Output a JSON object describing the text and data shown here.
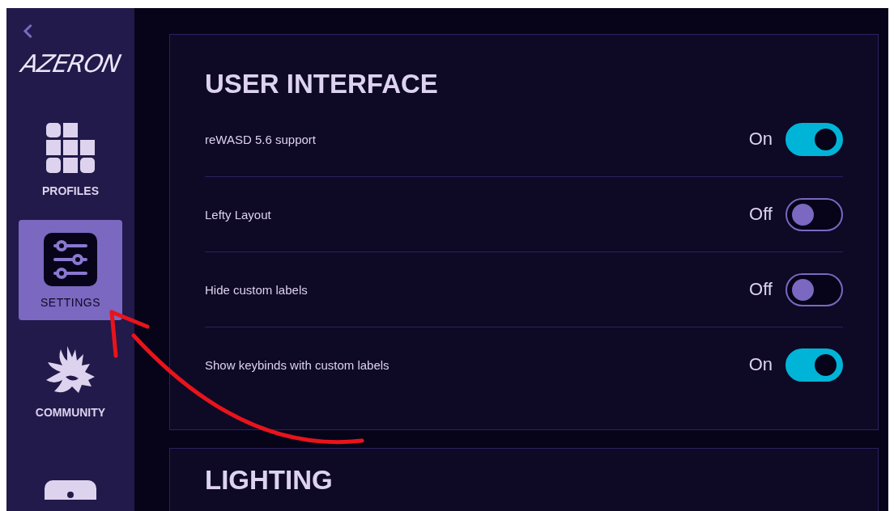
{
  "sidebar": {
    "logo": "AZERON",
    "items": [
      {
        "kind": "profiles",
        "label": "PROFILES",
        "selected": false
      },
      {
        "kind": "settings",
        "label": "SETTINGS",
        "selected": true
      },
      {
        "kind": "community",
        "label": "COMMUNITY",
        "selected": false
      },
      {
        "kind": "info",
        "selected": false
      }
    ]
  },
  "sections": [
    {
      "title": "USER INTERFACE",
      "rows": [
        {
          "label": "reWASD 5.6 support",
          "state": "On",
          "on": true
        },
        {
          "label": "Lefty Layout",
          "state": "Off",
          "on": false
        },
        {
          "label": "Hide custom labels",
          "state": "Off",
          "on": false
        },
        {
          "label": "Show keybinds with custom labels",
          "state": "On",
          "on": true
        }
      ]
    },
    {
      "title": "LIGHTING"
    }
  ]
}
